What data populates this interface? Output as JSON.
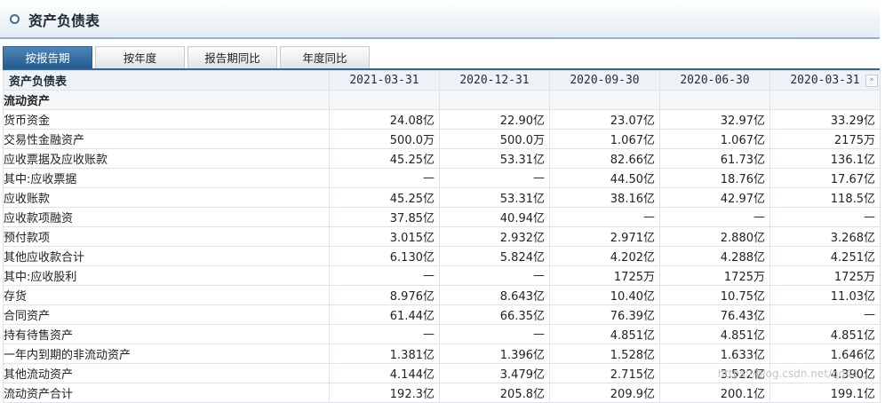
{
  "page": {
    "title": "资产负债表"
  },
  "tabs": [
    {
      "label": "按报告期",
      "active": true
    },
    {
      "label": "按年度",
      "active": false
    },
    {
      "label": "报告期同比",
      "active": false
    },
    {
      "label": "年度同比",
      "active": false
    }
  ],
  "table": {
    "header_label": "资产负债表",
    "dates": [
      "2021-03-31",
      "2020-12-31",
      "2020-09-30",
      "2020-06-30",
      "2020-03-31"
    ],
    "more_icon": "double-chevron-right-icon",
    "rows": [
      {
        "label": "流动资产",
        "level": 0,
        "section": true,
        "values": [
          "",
          "",
          "",
          "",
          ""
        ]
      },
      {
        "label": "货币资金",
        "level": 1,
        "values": [
          "24.08亿",
          "22.90亿",
          "23.07亿",
          "32.97亿",
          "33.29亿"
        ]
      },
      {
        "label": "交易性金融资产",
        "level": 1,
        "values": [
          "500.0万",
          "500.0万",
          "1.067亿",
          "1.067亿",
          "2175万"
        ]
      },
      {
        "label": "应收票据及应收账款",
        "level": 1,
        "values": [
          "45.25亿",
          "53.31亿",
          "82.66亿",
          "61.73亿",
          "136.1亿"
        ]
      },
      {
        "label": "其中:应收票据",
        "level": 1,
        "values": [
          "—",
          "—",
          "44.50亿",
          "18.76亿",
          "17.67亿"
        ]
      },
      {
        "label": "应收账款",
        "level": 2,
        "values": [
          "45.25亿",
          "53.31亿",
          "38.16亿",
          "42.97亿",
          "118.5亿"
        ]
      },
      {
        "label": "应收款项融资",
        "level": 1,
        "values": [
          "37.85亿",
          "40.94亿",
          "—",
          "—",
          "—"
        ]
      },
      {
        "label": "预付款项",
        "level": 1,
        "values": [
          "3.015亿",
          "2.932亿",
          "2.971亿",
          "2.880亿",
          "3.268亿"
        ]
      },
      {
        "label": "其他应收款合计",
        "level": 1,
        "values": [
          "6.130亿",
          "5.824亿",
          "4.202亿",
          "4.288亿",
          "4.251亿"
        ]
      },
      {
        "label": "其中:应收股利",
        "level": 1,
        "values": [
          "—",
          "—",
          "1725万",
          "1725万",
          "1725万"
        ]
      },
      {
        "label": "存货",
        "level": 1,
        "values": [
          "8.976亿",
          "8.643亿",
          "10.40亿",
          "10.75亿",
          "11.03亿"
        ]
      },
      {
        "label": "合同资产",
        "level": 1,
        "values": [
          "61.44亿",
          "66.35亿",
          "76.39亿",
          "76.43亿",
          "—"
        ]
      },
      {
        "label": "持有待售资产",
        "level": 1,
        "values": [
          "—",
          "—",
          "4.851亿",
          "4.851亿",
          "4.851亿"
        ]
      },
      {
        "label": "一年内到期的非流动资产",
        "level": 1,
        "values": [
          "1.381亿",
          "1.396亿",
          "1.528亿",
          "1.633亿",
          "1.646亿"
        ]
      },
      {
        "label": "其他流动资产",
        "level": 1,
        "values": [
          "4.144亿",
          "3.479亿",
          "2.715亿",
          "3.522亿",
          "4.390亿"
        ]
      },
      {
        "label": "流动资产合计",
        "level": 0,
        "values": [
          "192.3亿",
          "205.8亿",
          "209.9亿",
          "200.1亿",
          "199.1亿"
        ]
      }
    ]
  },
  "watermark": "https://blog.csdn.net/qq41..."
}
